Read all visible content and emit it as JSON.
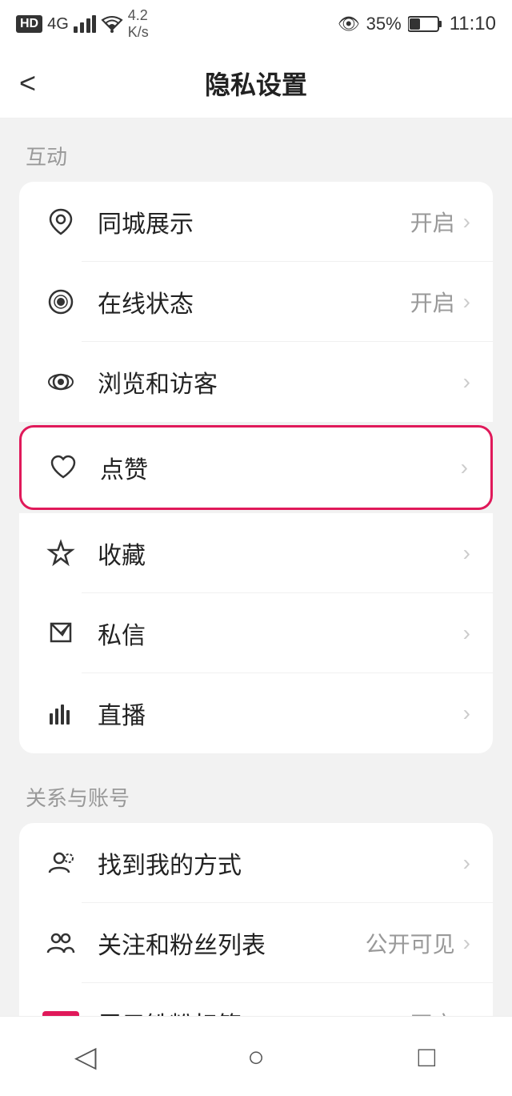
{
  "statusBar": {
    "left": "HD 4G",
    "network": "4.2 K/s",
    "eye": "👁",
    "battery": "35%",
    "time": "11:10"
  },
  "header": {
    "backLabel": "<",
    "title": "隐私设置"
  },
  "sections": [
    {
      "label": "互动",
      "items": [
        {
          "id": "location",
          "icon": "location",
          "text": "同城展示",
          "value": "开启",
          "arrow": true,
          "highlighted": false
        },
        {
          "id": "online",
          "icon": "online",
          "text": "在线状态",
          "value": "开启",
          "arrow": true,
          "highlighted": false
        },
        {
          "id": "browse",
          "icon": "browse",
          "text": "浏览和访客",
          "value": "",
          "arrow": true,
          "highlighted": false
        },
        {
          "id": "like",
          "icon": "like",
          "text": "点赞",
          "value": "",
          "arrow": true,
          "highlighted": true
        },
        {
          "id": "collect",
          "icon": "collect",
          "text": "收藏",
          "value": "",
          "arrow": true,
          "highlighted": false
        },
        {
          "id": "message",
          "icon": "message",
          "text": "私信",
          "value": "",
          "arrow": true,
          "highlighted": false
        },
        {
          "id": "live",
          "icon": "live",
          "text": "直播",
          "value": "",
          "arrow": true,
          "highlighted": false
        }
      ]
    },
    {
      "label": "关系与账号",
      "items": [
        {
          "id": "find",
          "icon": "find",
          "text": "找到我的方式",
          "value": "",
          "arrow": true,
          "highlighted": false
        },
        {
          "id": "follow",
          "icon": "follow",
          "text": "关注和粉丝列表",
          "value": "公开可见",
          "arrow": true,
          "highlighted": false
        },
        {
          "id": "tiefen",
          "icon": "tiefen",
          "text": "展示铁粉标签",
          "value": "开启",
          "arrow": true,
          "highlighted": false
        }
      ]
    }
  ],
  "bottomNav": {
    "back": "◁",
    "home": "○",
    "recent": "□"
  }
}
